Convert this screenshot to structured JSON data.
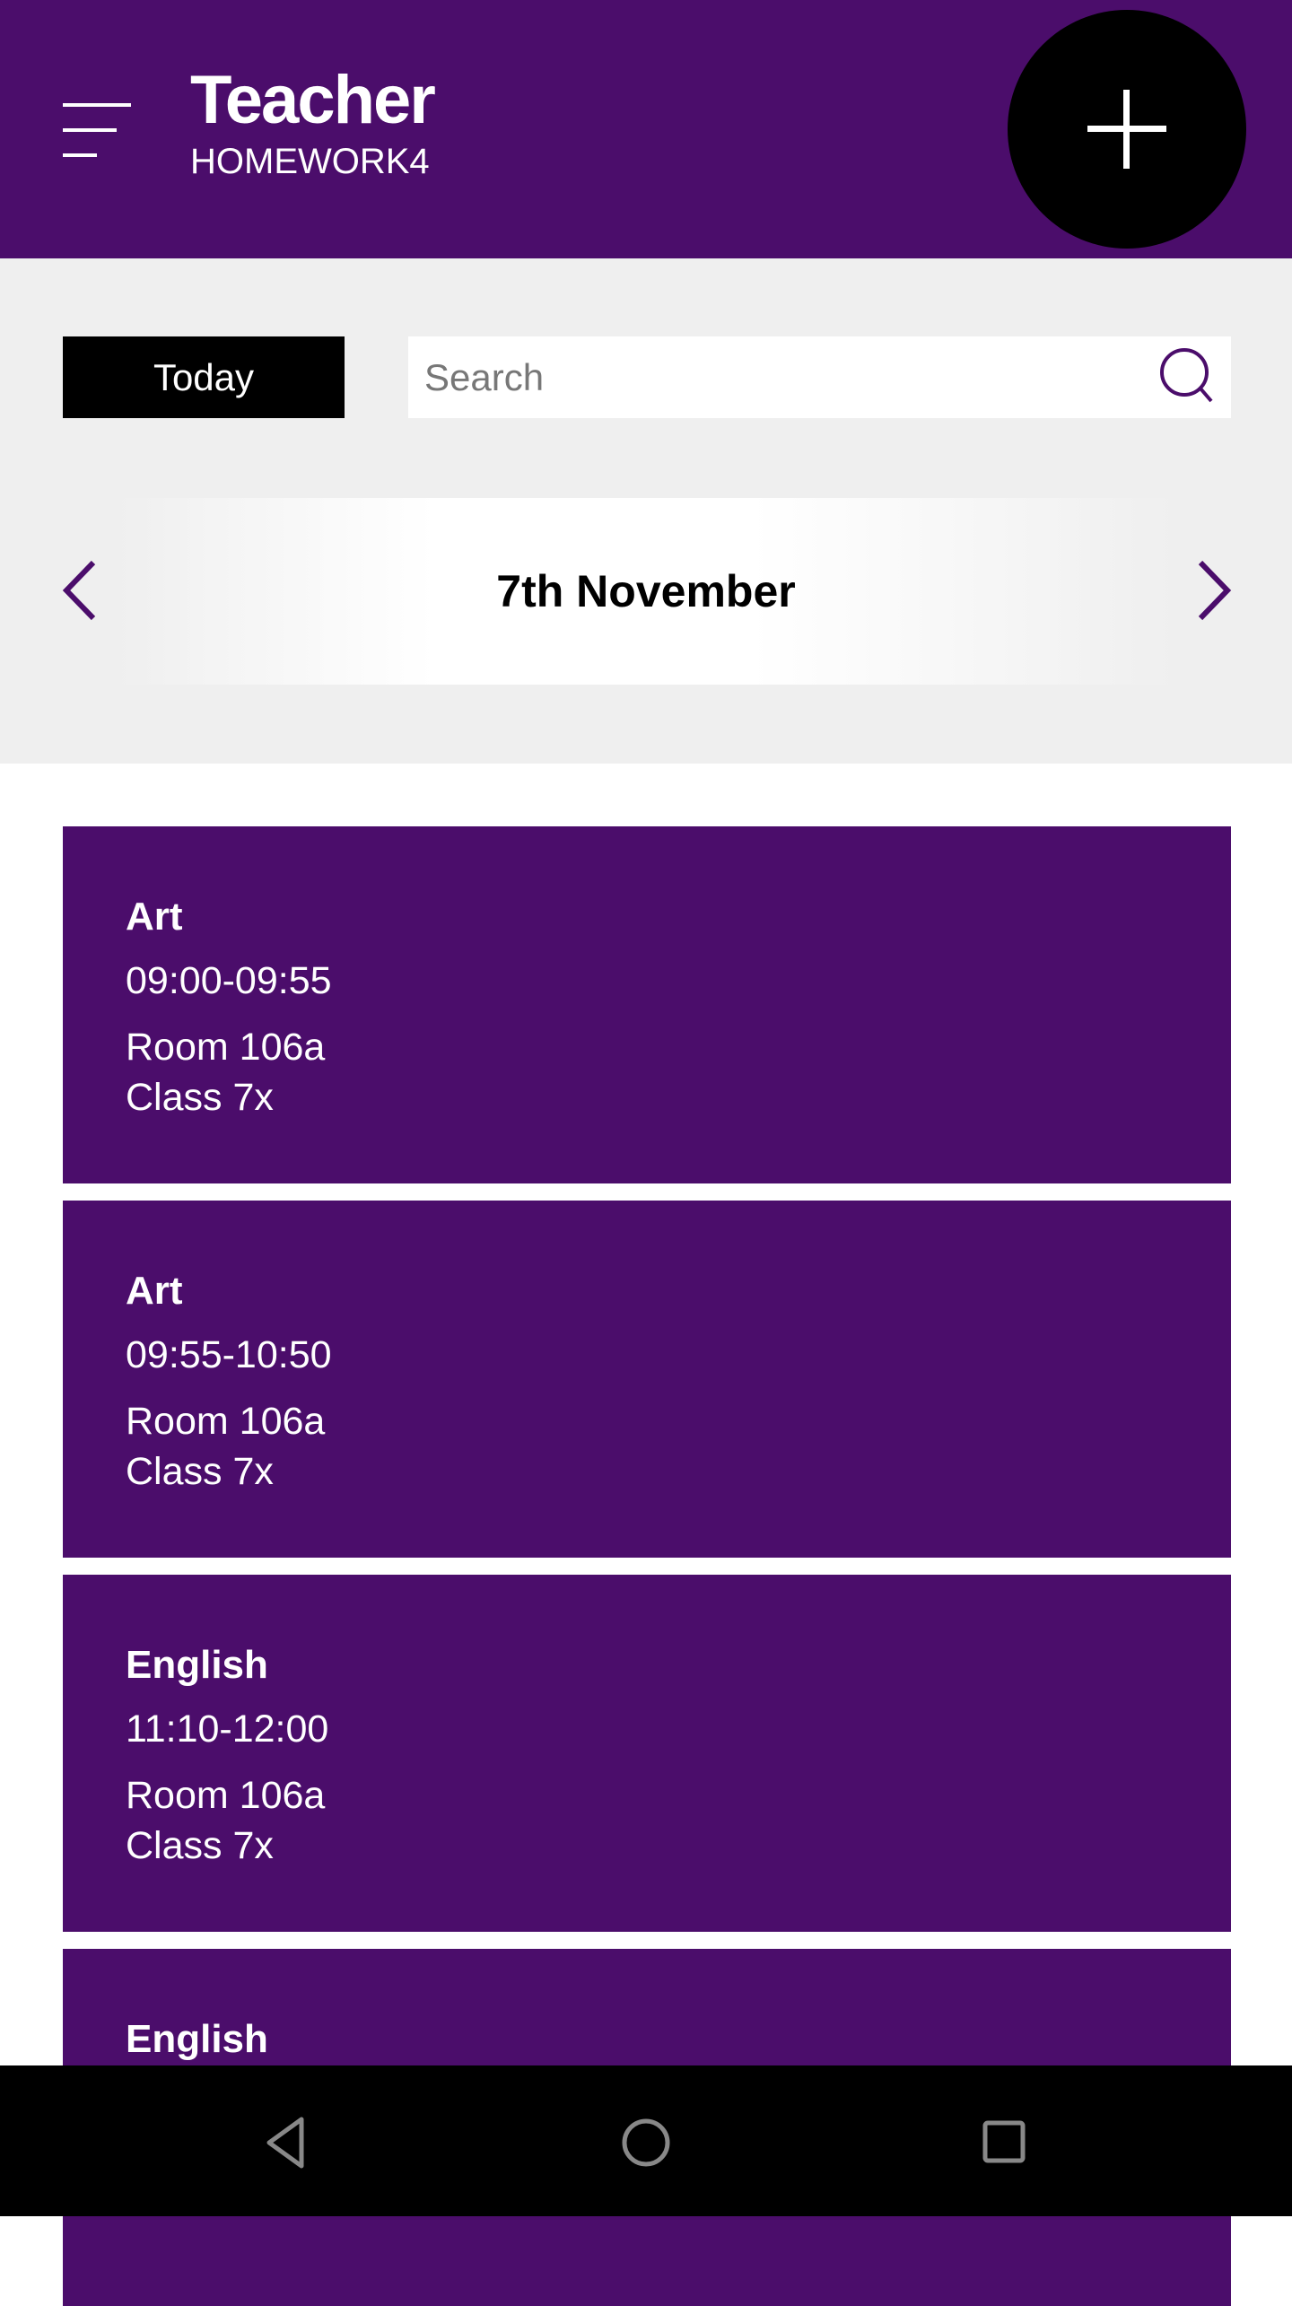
{
  "header": {
    "title": "Teacher",
    "subtitle": "HOMEWORK4",
    "add_icon": "plus-icon",
    "menu_icon": "menu-icon"
  },
  "toolbar": {
    "today_label": "Today",
    "search_placeholder": "Search",
    "search_value": ""
  },
  "date_nav": {
    "date": "7th November",
    "prev_icon": "chevron-left-icon",
    "next_icon": "chevron-right-icon"
  },
  "lessons": [
    {
      "subject": "Art",
      "time": "09:00-09:55",
      "room": "Room 106a",
      "class": "Class 7x"
    },
    {
      "subject": "Art",
      "time": "09:55-10:50",
      "room": "Room 106a",
      "class": "Class 7x"
    },
    {
      "subject": "English",
      "time": "11:10-12:00",
      "room": "Room 106a",
      "class": "Class 7x"
    },
    {
      "subject": "English",
      "time": "",
      "room": "",
      "class": ""
    }
  ],
  "colors": {
    "brand": "#4b0d6b",
    "background": "#efefef"
  }
}
